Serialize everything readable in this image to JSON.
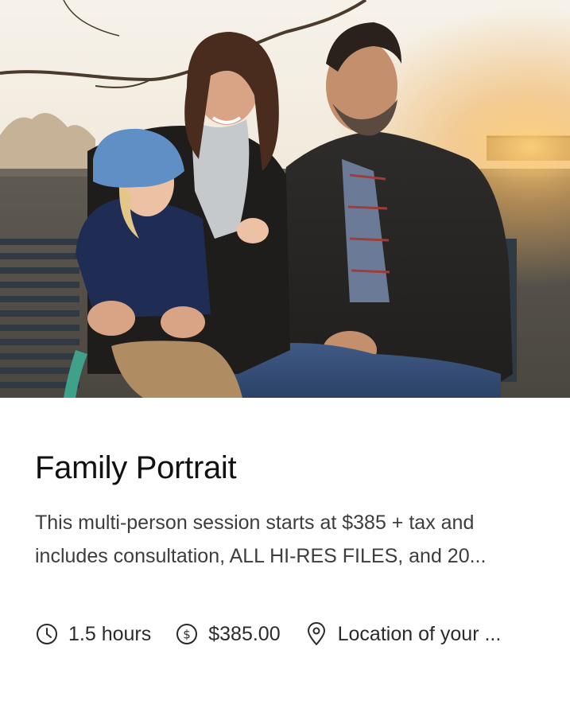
{
  "service": {
    "title": "Family Portrait",
    "description_lines": [
      "This multi-person session starts at $385 + tax and",
      "includes consultation, ALL HI-RES FILES, and 20..."
    ],
    "duration": "1.5 hours",
    "price": "$385.00",
    "location": "Location of your ..."
  },
  "icons": {
    "duration": "clock-icon",
    "price": "dollar-circle-icon",
    "location": "map-pin-icon"
  },
  "colors": {
    "title": "#111111",
    "text": "#3d3d3d",
    "icon": "#2b2b2b"
  }
}
